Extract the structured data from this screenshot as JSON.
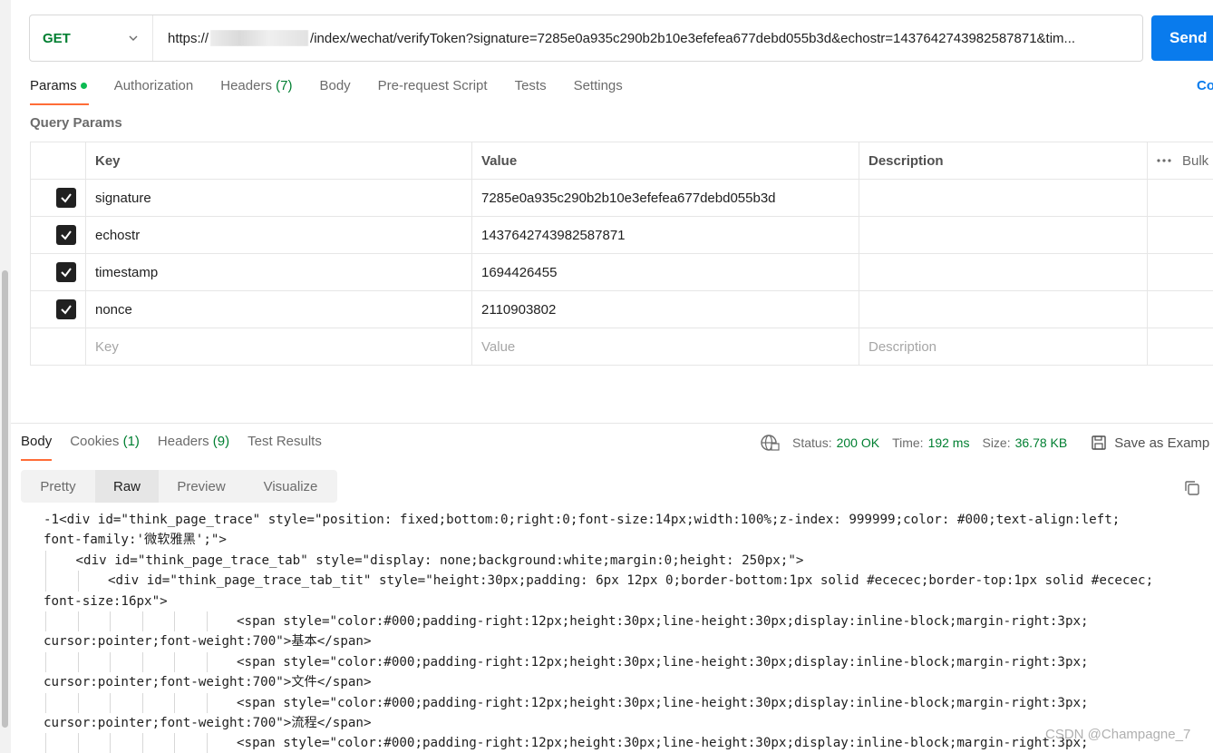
{
  "request": {
    "method": "GET",
    "url_prefix": "https://",
    "url_suffix": "/index/wechat/verifyToken?signature=7285e0a935c290b2b10e3efefea677debd055b3d&echostr=1437642743982587871&tim...",
    "send_label": "Send"
  },
  "tabs": [
    {
      "label": "Params",
      "active": true
    },
    {
      "label": "Authorization"
    },
    {
      "label": "Headers",
      "count": "(7)"
    },
    {
      "label": "Body"
    },
    {
      "label": "Pre-request Script"
    },
    {
      "label": "Tests"
    },
    {
      "label": "Settings"
    }
  ],
  "cookies_link": "Co",
  "query_params": {
    "title": "Query Params",
    "headers": {
      "key": "Key",
      "value": "Value",
      "description": "Description",
      "bulk": "Bulk"
    },
    "rows": [
      {
        "key": "signature",
        "value": "7285e0a935c290b2b10e3efefea677debd055b3d",
        "description": ""
      },
      {
        "key": "echostr",
        "value": "1437642743982587871",
        "description": ""
      },
      {
        "key": "timestamp",
        "value": "1694426455",
        "description": ""
      },
      {
        "key": "nonce",
        "value": "2110903802",
        "description": ""
      }
    ],
    "placeholders": {
      "key": "Key",
      "value": "Value",
      "description": "Description"
    }
  },
  "response": {
    "tabs": [
      {
        "label": "Body",
        "active": true
      },
      {
        "label": "Cookies",
        "count": "(1)"
      },
      {
        "label": "Headers",
        "count": "(9)"
      },
      {
        "label": "Test Results"
      }
    ],
    "status_label": "Status:",
    "status_value": "200 OK",
    "time_label": "Time:",
    "time_value": "192 ms",
    "size_label": "Size:",
    "size_value": "36.78 KB",
    "save_as": "Save as Examp",
    "views": [
      "Pretty",
      "Raw",
      "Preview",
      "Visualize"
    ],
    "active_view": "Raw",
    "code_lines": [
      {
        "indent": 0,
        "text": "-1<div id=\"think_page_trace\" style=\"position: fixed;bottom:0;right:0;font-size:14px;width:100%;z-index: 999999;color: #000;text-align:left;"
      },
      {
        "indent": 0,
        "text": "font-family:'微软雅黑';\">"
      },
      {
        "indent": 1,
        "text": "<div id=\"think_page_trace_tab\" style=\"display: none;background:white;margin:0;height: 250px;\">"
      },
      {
        "indent": 2,
        "text": "<div id=\"think_page_trace_tab_tit\" style=\"height:30px;padding: 6px 12px 0;border-bottom:1px solid #ececec;border-top:1px solid #ececec;"
      },
      {
        "indent": 0,
        "text": "font-size:16px\">"
      },
      {
        "indent": 6,
        "text": "<span style=\"color:#000;padding-right:12px;height:30px;line-height:30px;display:inline-block;margin-right:3px;"
      },
      {
        "indent": 0,
        "text": "cursor:pointer;font-weight:700\">基本</span>"
      },
      {
        "indent": 6,
        "text": "<span style=\"color:#000;padding-right:12px;height:30px;line-height:30px;display:inline-block;margin-right:3px;"
      },
      {
        "indent": 0,
        "text": "cursor:pointer;font-weight:700\">文件</span>"
      },
      {
        "indent": 6,
        "text": "<span style=\"color:#000;padding-right:12px;height:30px;line-height:30px;display:inline-block;margin-right:3px;"
      },
      {
        "indent": 0,
        "text": "cursor:pointer;font-weight:700\">流程</span>"
      },
      {
        "indent": 6,
        "text": "<span style=\"color:#000;padding-right:12px;height:30px;line-height:30px;display:inline-block;margin-right:3px;"
      }
    ]
  },
  "watermark": "CSDN @Champagne_7",
  "colors": {
    "accent": "#097bed",
    "tab_underline": "#ff6c37",
    "success": "#007f31",
    "params_dot": "#0cbb52"
  }
}
